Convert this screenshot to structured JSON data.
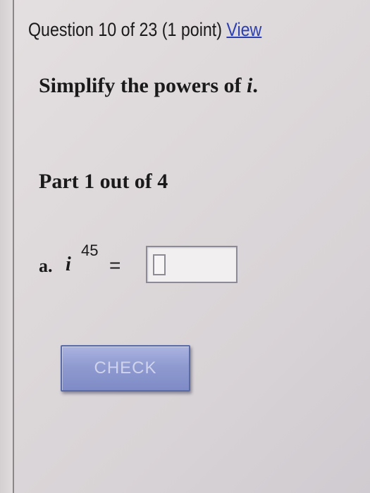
{
  "question": {
    "header_text": "Question 10 of 23 (1 point)",
    "view_link": "View"
  },
  "instruction": {
    "text": "Simplify the powers of",
    "variable": "i",
    "period": "."
  },
  "part": {
    "label": "Part 1 out of 4"
  },
  "problem": {
    "label": "a.",
    "base": "i",
    "exponent": "45",
    "equals": "=",
    "answer_value": ""
  },
  "buttons": {
    "check_label": "CHECK"
  }
}
